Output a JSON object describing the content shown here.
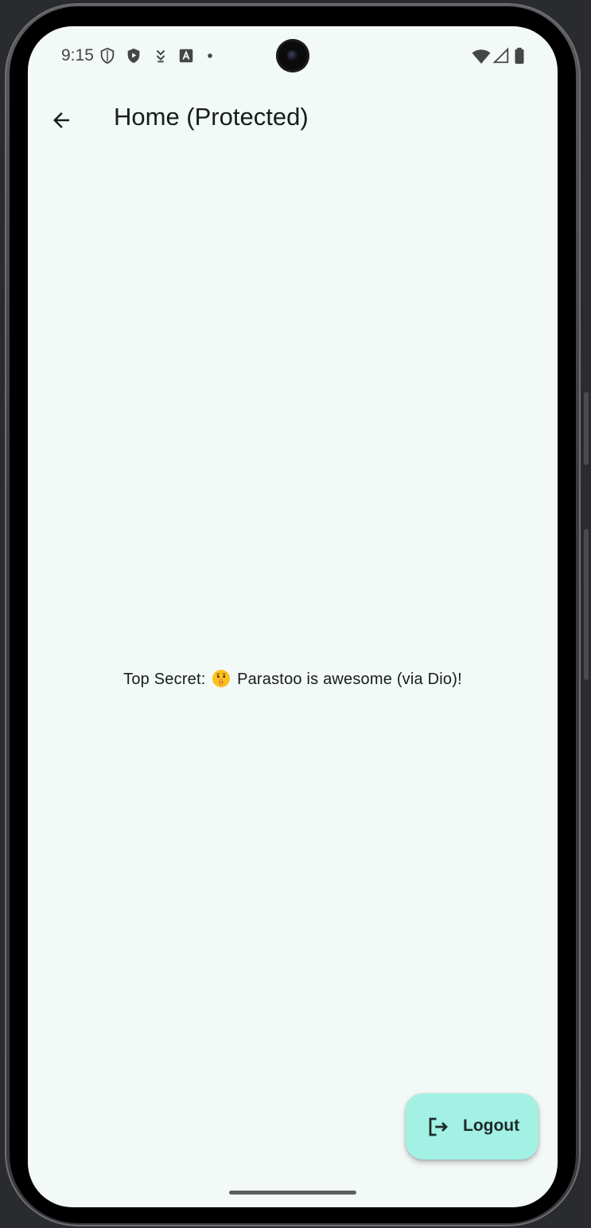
{
  "status_bar": {
    "time": "9:15",
    "icons": [
      "shield-outline-icon",
      "play-protect-icon",
      "download-arrow-icon",
      "translate-a-icon",
      "notification-dot-icon",
      "wifi-icon",
      "cellular-signal-icon",
      "battery-icon"
    ]
  },
  "app_bar": {
    "back_icon": "arrow-back-icon",
    "title": "Home (Protected)"
  },
  "main": {
    "message_prefix": "Top Secret:",
    "message_emoji": "shushing-face-emoji",
    "message_suffix": "Parastoo is awesome (via Dio)!"
  },
  "fab": {
    "icon": "logout-icon",
    "label": "Logout",
    "color": "#a3f0e4"
  },
  "colors": {
    "background": "#f3f9f7",
    "text": "#171d1c"
  }
}
